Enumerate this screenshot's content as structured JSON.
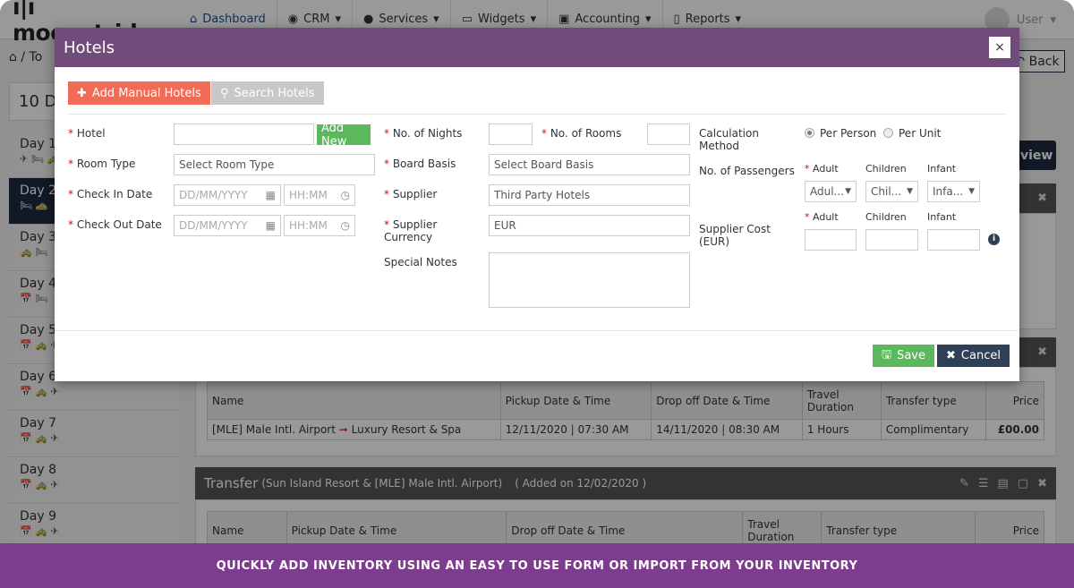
{
  "nav": {
    "logo": "ı|ı moonstride",
    "items": [
      {
        "label": "Dashboard",
        "icon": "home-icon"
      },
      {
        "label": "CRM",
        "icon": "user-circle-icon"
      },
      {
        "label": "Services",
        "icon": "globe-icon"
      },
      {
        "label": "Widgets",
        "icon": "folder-icon"
      },
      {
        "label": "Accounting",
        "icon": "money-icon"
      },
      {
        "label": "Reports",
        "icon": "file-word-icon"
      }
    ],
    "user": "User"
  },
  "breadcrumb": {
    "text": "To"
  },
  "back_label": "Back",
  "itinerary_title": "10 D",
  "days": [
    {
      "label": "Day 1",
      "icons": "✈ 🛏 🚕"
    },
    {
      "label": "Day 2",
      "icons": "🛏 🚕"
    },
    {
      "label": "Day 3",
      "icons": "🚕 🛏"
    },
    {
      "label": "Day 4",
      "icons": "📅 🛏"
    },
    {
      "label": "Day 5",
      "icons": "📅 🚕 ✈"
    },
    {
      "label": "Day 6",
      "icons": "📅 🚕 ✈"
    },
    {
      "label": "Day 7",
      "icons": "📅 🚕 ✈"
    },
    {
      "label": "Day 8",
      "icons": "📅 🚕 ✈"
    },
    {
      "label": "Day 9",
      "icons": "📅 🚕 ✈"
    }
  ],
  "view_label": "view",
  "transfer_table": {
    "headers": [
      "Name",
      "Pickup Date & Time",
      "Drop off Date & Time",
      "Travel Duration",
      "Transfer type",
      "Price"
    ],
    "row": {
      "from": "[MLE] Male Intl. Airport",
      "to": "Luxury Resort & Spa",
      "pickup_date": "12/11/2020",
      "pickup_time": "07:30 AM",
      "drop_date": "14/11/2020",
      "drop_time": "08:30 AM",
      "duration": "1 Hours",
      "type": "Complimentary",
      "price": "£00.00"
    }
  },
  "transfer2": {
    "title": "Transfer",
    "route": "(Sun Island Resort & [MLE] Male Intl. Airport)",
    "added": "( Added on 12/02/2020 )"
  },
  "modal": {
    "title": "Hotels",
    "close": "×",
    "add_manual": "Add Manual Hotels",
    "search_hotels": "Search Hotels",
    "hotel_label": "Hotel",
    "add_new": "Add New",
    "room_type_label": "Room Type",
    "room_type_value": "Select Room Type",
    "check_in_label": "Check In Date",
    "check_out_label": "Check Out Date",
    "date_placeholder": "DD/MM/YYYY",
    "time_placeholder": "HH:MM",
    "nights_label": "No. of Nights",
    "rooms_label": "No. of Rooms",
    "board_label": "Board Basis",
    "board_value": "Select Board Basis",
    "supplier_label": "Supplier",
    "supplier_value": "Third Party Hotels",
    "currency_label": "Supplier Currency",
    "currency_value": "EUR",
    "notes_label": "Special Notes",
    "calc_label": "Calculation Method",
    "per_person": "Per Person",
    "per_unit": "Per Unit",
    "passengers_label": "No. of Passengers",
    "adult": "Adult",
    "children": "Children",
    "infant": "Infant",
    "adult_sel": "Adul...",
    "children_sel": "Chil...",
    "infant_sel": "Infa...",
    "cost_label": "Supplier Cost (EUR)",
    "save": "Save",
    "cancel": "Cancel"
  },
  "colors": {
    "header": "#714b7a",
    "add_manual": "#f26b56",
    "search": "#c8c8c8",
    "save": "#5cb85c",
    "cancel": "#2e4057",
    "banner": "#7d3c8e",
    "selected_day": "#1d2b40"
  },
  "banner": "QUICKLY ADD INVENTORY USING AN EASY TO USE FORM OR IMPORT FROM YOUR INVENTORY"
}
